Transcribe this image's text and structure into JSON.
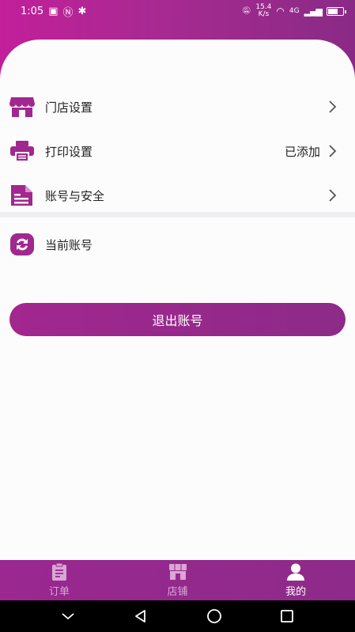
{
  "status_bar": {
    "time": "1:05",
    "speed": "15.4 K/s",
    "network": "4G"
  },
  "menu": {
    "store_settings": {
      "label": "门店设置",
      "value": ""
    },
    "print_settings": {
      "label": "打印设置",
      "value": "已添加"
    },
    "account_security": {
      "label": "账号与安全",
      "value": ""
    },
    "current_account": {
      "label": "当前账号"
    }
  },
  "logout_label": "退出账号",
  "tabs": [
    {
      "label": "订单",
      "icon": "clipboard-icon",
      "active": false
    },
    {
      "label": "店铺",
      "icon": "store-icon",
      "active": false
    },
    {
      "label": "我的",
      "icon": "person-icon",
      "active": true
    }
  ],
  "colors": {
    "primary": "#9a2890",
    "header_start": "#c21f9a",
    "header_end": "#8a2a86",
    "tab_inactive": "#d9a7d4"
  }
}
